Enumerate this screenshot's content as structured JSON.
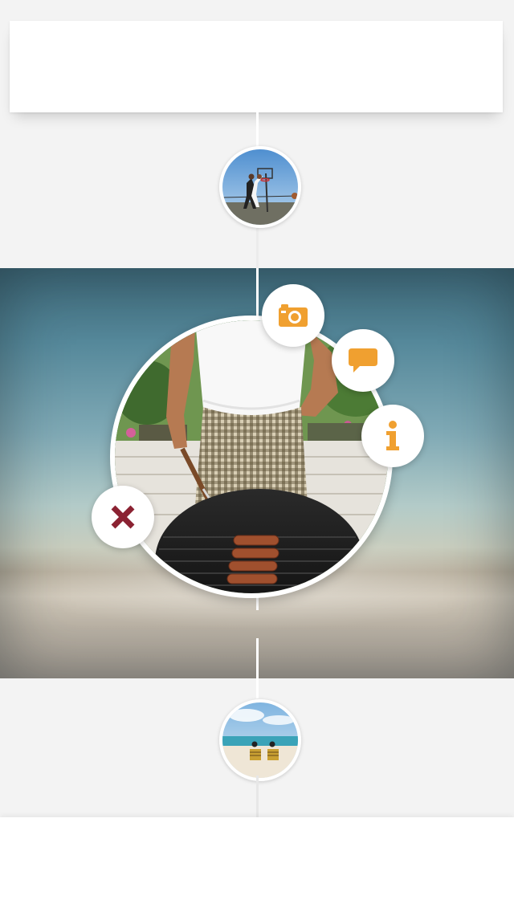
{
  "timeline": {
    "top_card_text": "",
    "bottom_card_text": ""
  },
  "thumbnails": [
    {
      "subject": "basketball-players"
    },
    {
      "subject": "beach-chairs"
    }
  ],
  "main_photo": {
    "subject": "man-grilling-sausages"
  },
  "actions": {
    "camera_icon": "camera-icon",
    "comment_icon": "speech-bubble-icon",
    "info_icon": "info-icon",
    "close_icon": "close-icon"
  },
  "colors": {
    "accent_orange": "#f0a030",
    "close_red": "#8b2232",
    "background": "#f3f3f3"
  }
}
